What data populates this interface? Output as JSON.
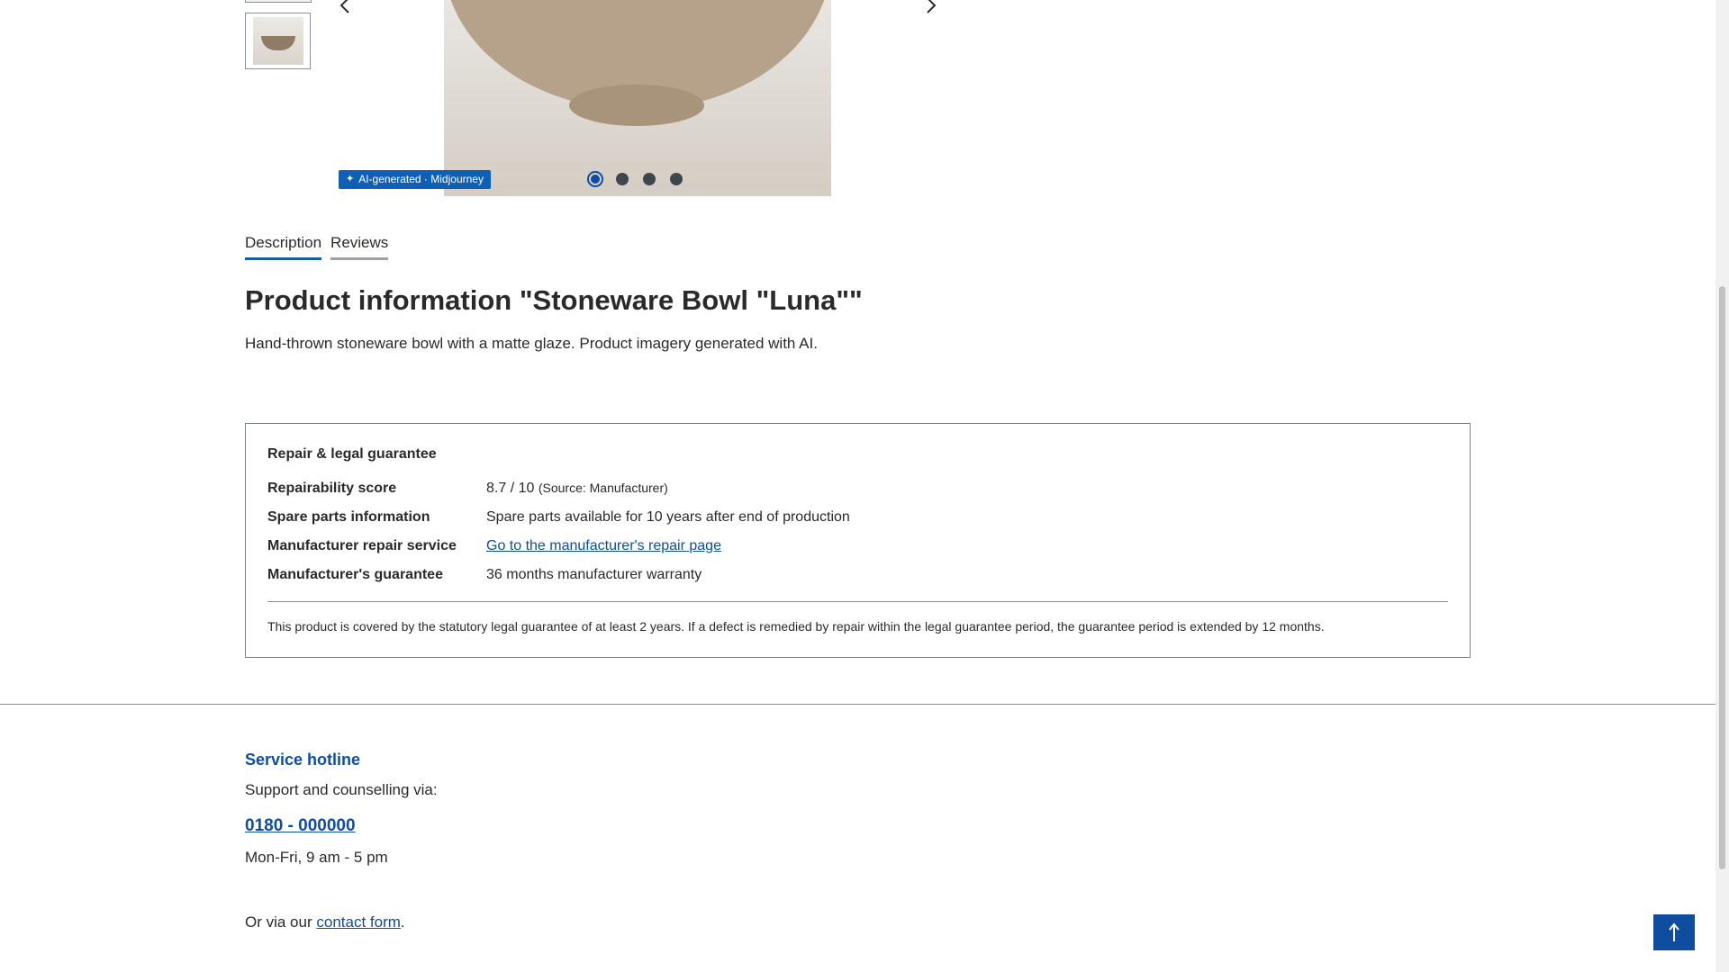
{
  "gallery": {
    "ai_badge": "AI-generated · Midjourney",
    "slides": [
      {
        "active": true
      },
      {
        "active": false
      },
      {
        "active": false
      },
      {
        "active": false
      }
    ]
  },
  "tabs": [
    {
      "label": "Description",
      "active": true
    },
    {
      "label": "Reviews",
      "active": false
    }
  ],
  "product": {
    "title": "Product information \"Stoneware Bowl \"Luna\"\"",
    "description": "Hand-thrown stoneware bowl with a matte glaze. Product imagery generated with AI."
  },
  "repair": {
    "heading": "Repair & legal guarantee",
    "rows": {
      "repairability": {
        "label": "Repairability score",
        "value": "8.7 / 10",
        "source": "(Source: Manufacturer)"
      },
      "spare_parts": {
        "label": "Spare parts information",
        "value": "Spare parts available for 10 years after end of production"
      },
      "repair_service": {
        "label": "Manufacturer repair service",
        "link": "Go to the manufacturer's repair page"
      },
      "guarantee": {
        "label": "Manufacturer's guarantee",
        "value": "36 months manufacturer warranty"
      }
    },
    "note": "This product is covered by the statutory legal guarantee of at least 2 years. If a defect is remedied by repair within the legal guarantee period, the guarantee period is extended by 12 months."
  },
  "service": {
    "title": "Service hotline",
    "subtitle": "Support and counselling via:",
    "phone": "0180 - 000000",
    "hours": "Mon-Fri, 9 am - 5 pm",
    "contact_prefix": "Or via our",
    "contact_link": "contact form",
    "contact_suffix": "."
  },
  "icons": {
    "prev": "chevron-left-icon",
    "next": "chevron-right-icon",
    "back_to_top": "arrow-up-icon",
    "badge": "sparkle-icon"
  },
  "colors": {
    "accent": "#0f4da0",
    "badge": "#0f5fb4",
    "text": "#2a2a2a"
  }
}
